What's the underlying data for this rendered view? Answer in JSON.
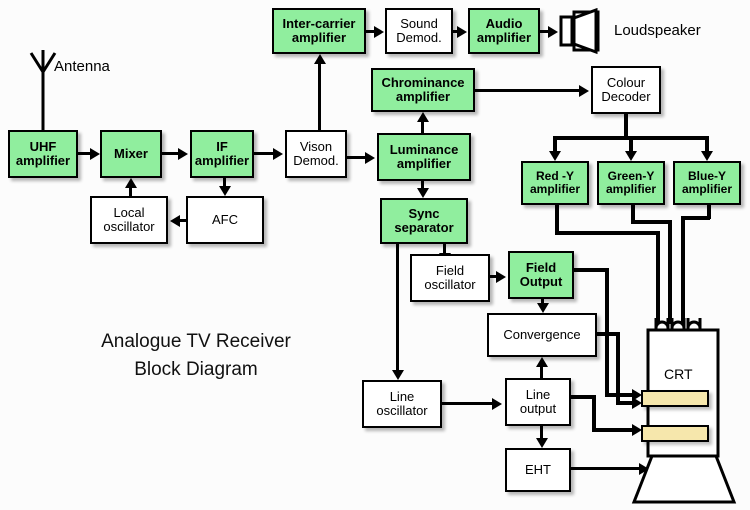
{
  "diagram": {
    "title_line1": "Analogue TV Receiver",
    "title_line2": "Block Diagram",
    "accent_green": "#90ee9e",
    "coil_color": "#f6e7ac",
    "line_color": "#000000",
    "background": "#fcfcfc"
  },
  "labels": {
    "antenna": "Antenna",
    "loudspeaker": "Loudspeaker",
    "crt": "CRT"
  },
  "blocks": [
    {
      "id": "uhf-amplifier",
      "line1": "UHF",
      "line2": "amplifier",
      "color": "green"
    },
    {
      "id": "mixer",
      "line1": "Mixer",
      "line2": "",
      "color": "green"
    },
    {
      "id": "if-amplifier",
      "line1": "IF",
      "line2": "amplifier",
      "color": "green"
    },
    {
      "id": "vison-demod",
      "line1": "Vison",
      "line2": "Demod.",
      "color": "white"
    },
    {
      "id": "local-oscillator",
      "line1": "Local",
      "line2": "oscillator",
      "color": "white"
    },
    {
      "id": "afc",
      "line1": "AFC",
      "line2": "",
      "color": "white"
    },
    {
      "id": "inter-carrier-amplifier",
      "line1": "Inter-carrier",
      "line2": "amplifier",
      "color": "green"
    },
    {
      "id": "sound-demod",
      "line1": "Sound",
      "line2": "Demod.",
      "color": "white"
    },
    {
      "id": "audio-amplifier",
      "line1": "Audio",
      "line2": "amplifier",
      "color": "green"
    },
    {
      "id": "chrominance-amplifier",
      "line1": "Chrominance",
      "line2": "amplifier",
      "color": "green"
    },
    {
      "id": "luminance-amplifier",
      "line1": "Luminance",
      "line2": "amplifier",
      "color": "green"
    },
    {
      "id": "sync-separator",
      "line1": "Sync",
      "line2": "separator",
      "color": "green"
    },
    {
      "id": "colour-decoder",
      "line1": "Colour",
      "line2": "Decoder",
      "color": "white"
    },
    {
      "id": "red-y-amplifier",
      "line1": "Red -Y",
      "line2": "amplifier",
      "color": "green"
    },
    {
      "id": "green-y-amplifier",
      "line1": "Green-Y",
      "line2": "amplifier",
      "color": "green"
    },
    {
      "id": "blue-y-amplifier",
      "line1": "Blue-Y",
      "line2": "amplifier",
      "color": "green"
    },
    {
      "id": "field-oscillator",
      "line1": "Field",
      "line2": "oscillator",
      "color": "white"
    },
    {
      "id": "field-output",
      "line1": "Field",
      "line2": "Output",
      "color": "green"
    },
    {
      "id": "convergence",
      "line1": "Convergence",
      "line2": "",
      "color": "white"
    },
    {
      "id": "line-oscillator",
      "line1": "Line",
      "line2": "oscillator",
      "color": "white"
    },
    {
      "id": "line-output",
      "line1": "Line",
      "line2": "output",
      "color": "white"
    },
    {
      "id": "eht",
      "line1": "EHT",
      "line2": "",
      "color": "white"
    }
  ],
  "signal_flow": [
    "Antenna -> UHF amplifier",
    "UHF amplifier -> Mixer",
    "Local oscillator -> Mixer",
    "Mixer -> IF amplifier",
    "IF amplifier -> AFC",
    "AFC -> Local oscillator",
    "IF amplifier -> Vison Demod.",
    "Vison Demod. -> Inter-carrier amplifier",
    "Inter-carrier amplifier -> Sound Demod.",
    "Sound Demod. -> Audio amplifier",
    "Audio amplifier -> Loudspeaker",
    "Vison Demod. -> Luminance amplifier",
    "Luminance amplifier -> Chrominance amplifier",
    "Chrominance amplifier -> Colour Decoder",
    "Colour Decoder -> Red -Y amplifier",
    "Colour Decoder -> Green-Y amplifier",
    "Colour Decoder -> Blue-Y amplifier",
    "Red -Y amplifier -> CRT",
    "Green-Y amplifier -> CRT",
    "Blue-Y amplifier -> CRT",
    "Luminance amplifier -> Sync separator",
    "Sync separator -> Field oscillator",
    "Sync separator -> Line oscillator",
    "Field oscillator -> Field Output",
    "Field Output -> Convergence",
    "Field Output -> CRT field coil",
    "Line oscillator -> Line output",
    "Line output -> Convergence",
    "Line output -> EHT",
    "Line output -> CRT line coil",
    "Convergence -> CRT",
    "EHT -> CRT"
  ]
}
